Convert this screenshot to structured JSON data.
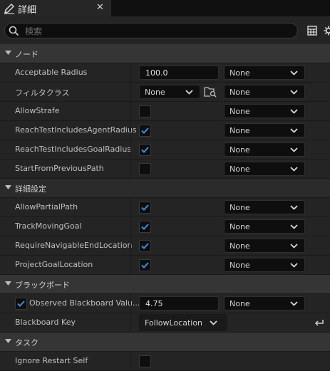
{
  "tab": {
    "title": "詳細",
    "close": "✕",
    "icon": "pencil-icon"
  },
  "search": {
    "placeholder": "検索",
    "icon": "search-icon"
  },
  "toolbar": {
    "icons": [
      "table-view-icon",
      "settings-gear-icon"
    ]
  },
  "categories": {
    "node": "ノード",
    "advanced": "詳細設定",
    "blackboard": "ブラックボード",
    "task": "タスク"
  },
  "node_rows": {
    "acceptable_radius": {
      "label": "Acceptable Radius",
      "value": "100.0",
      "option": "None"
    },
    "filter_class": {
      "label": "フィルタクラス",
      "value": "None",
      "option": "None"
    },
    "allow_strafe": {
      "label": "AllowStrafe",
      "checked": false,
      "option": "None"
    },
    "reach_agent": {
      "label": "ReachTestIncludesAgentRadius",
      "checked": true,
      "option": "None"
    },
    "reach_goal": {
      "label": "ReachTestIncludesGoalRadius",
      "checked": true,
      "option": "None"
    },
    "start_prev": {
      "label": "StartFromPreviousPath",
      "checked": false,
      "option": "None"
    }
  },
  "advanced_rows": {
    "allow_partial": {
      "label": "AllowPartialPath",
      "checked": true,
      "option": "None"
    },
    "track_moving": {
      "label": "TrackMovingGoal",
      "checked": true,
      "option": "None"
    },
    "require_nav": {
      "label": "RequireNavigableEndLocation",
      "checked": true,
      "option": "None"
    },
    "project_goal": {
      "label": "ProjectGoalLocation",
      "checked": true,
      "option": "None"
    }
  },
  "blackboard_rows": {
    "observed": {
      "label": "Observed Blackboard Valu...",
      "checked": true,
      "value": "4.75",
      "option": "None"
    },
    "key": {
      "label": "Blackboard Key",
      "value": "FollowLocation"
    }
  },
  "task_rows": {
    "ignore_restart": {
      "label": "Ignore Restart Self",
      "checked": false
    }
  },
  "colors": {
    "accent": "#3d8fe0",
    "panel": "#242424",
    "category": "#353535",
    "field": "#0e0e0e"
  }
}
